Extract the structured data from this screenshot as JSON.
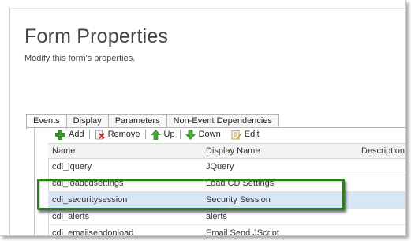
{
  "header": {
    "title": "Form Properties",
    "subtitle": "Modify this form's properties."
  },
  "tabs": [
    {
      "label": "Events"
    },
    {
      "label": "Display"
    },
    {
      "label": "Parameters"
    },
    {
      "label": "Non-Event Dependencies"
    }
  ],
  "toolbar": {
    "add": "Add",
    "remove": "Remove",
    "up": "Up",
    "down": "Down",
    "edit": "Edit"
  },
  "grid": {
    "columns": [
      "Name",
      "Display Name",
      "Description"
    ],
    "rows": [
      {
        "name": "cdi_jquery",
        "display": "JQuery"
      },
      {
        "name": "cdi_loadcdsettings",
        "display": "Load CD Settings"
      },
      {
        "name": "cdi_securitysession",
        "display": "Security Session"
      },
      {
        "name": "cdi_alerts",
        "display": "alerts"
      },
      {
        "name": "cdi_emailsendonload",
        "display": "Email Send JScript"
      }
    ]
  },
  "colors": {
    "highlight": "#2f7d1f",
    "selected_row": "#d8e7f8",
    "add_icon": "#3a9a2a",
    "arrow_icon": "#4aa838"
  },
  "icons": [
    "add-icon",
    "remove-icon",
    "up-arrow-icon",
    "down-arrow-icon",
    "edit-icon"
  ]
}
